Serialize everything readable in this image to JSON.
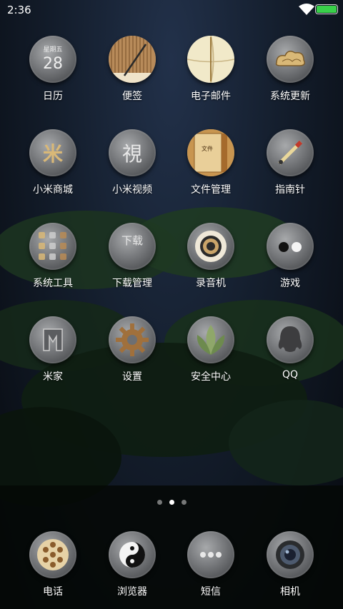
{
  "status_bar": {
    "time": "2:36",
    "battery_color": "#39d04a"
  },
  "apps": [
    {
      "label": "日历",
      "icon": "calendar-icon",
      "icon_text_top": "星期五",
      "icon_text": "28"
    },
    {
      "label": "便签",
      "icon": "notes-icon"
    },
    {
      "label": "电子邮件",
      "icon": "email-icon"
    },
    {
      "label": "系统更新",
      "icon": "update-cloud-icon"
    },
    {
      "label": "小米商城",
      "icon": "mi-store-icon",
      "icon_text": "米"
    },
    {
      "label": "小米视频",
      "icon": "video-icon",
      "icon_text": "視"
    },
    {
      "label": "文件管理",
      "icon": "file-manager-icon",
      "icon_text": "文件"
    },
    {
      "label": "指南针",
      "icon": "compass-icon"
    },
    {
      "label": "系统工具",
      "icon": "tools-folder-icon"
    },
    {
      "label": "下载管理",
      "icon": "download-icon",
      "icon_text": "下载"
    },
    {
      "label": "录音机",
      "icon": "recorder-icon"
    },
    {
      "label": "游戏",
      "icon": "game-icon"
    },
    {
      "label": "米家",
      "icon": "mijia-icon"
    },
    {
      "label": "设置",
      "icon": "settings-gear-icon"
    },
    {
      "label": "安全中心",
      "icon": "security-leaf-icon"
    },
    {
      "label": "QQ",
      "icon": "qq-icon"
    }
  ],
  "page_indicator": {
    "count": 3,
    "active_index": 1
  },
  "dock": [
    {
      "label": "电话",
      "icon": "phone-icon"
    },
    {
      "label": "浏览器",
      "icon": "browser-yinyang-icon"
    },
    {
      "label": "短信",
      "icon": "messages-icon"
    },
    {
      "label": "相机",
      "icon": "camera-icon"
    }
  ]
}
